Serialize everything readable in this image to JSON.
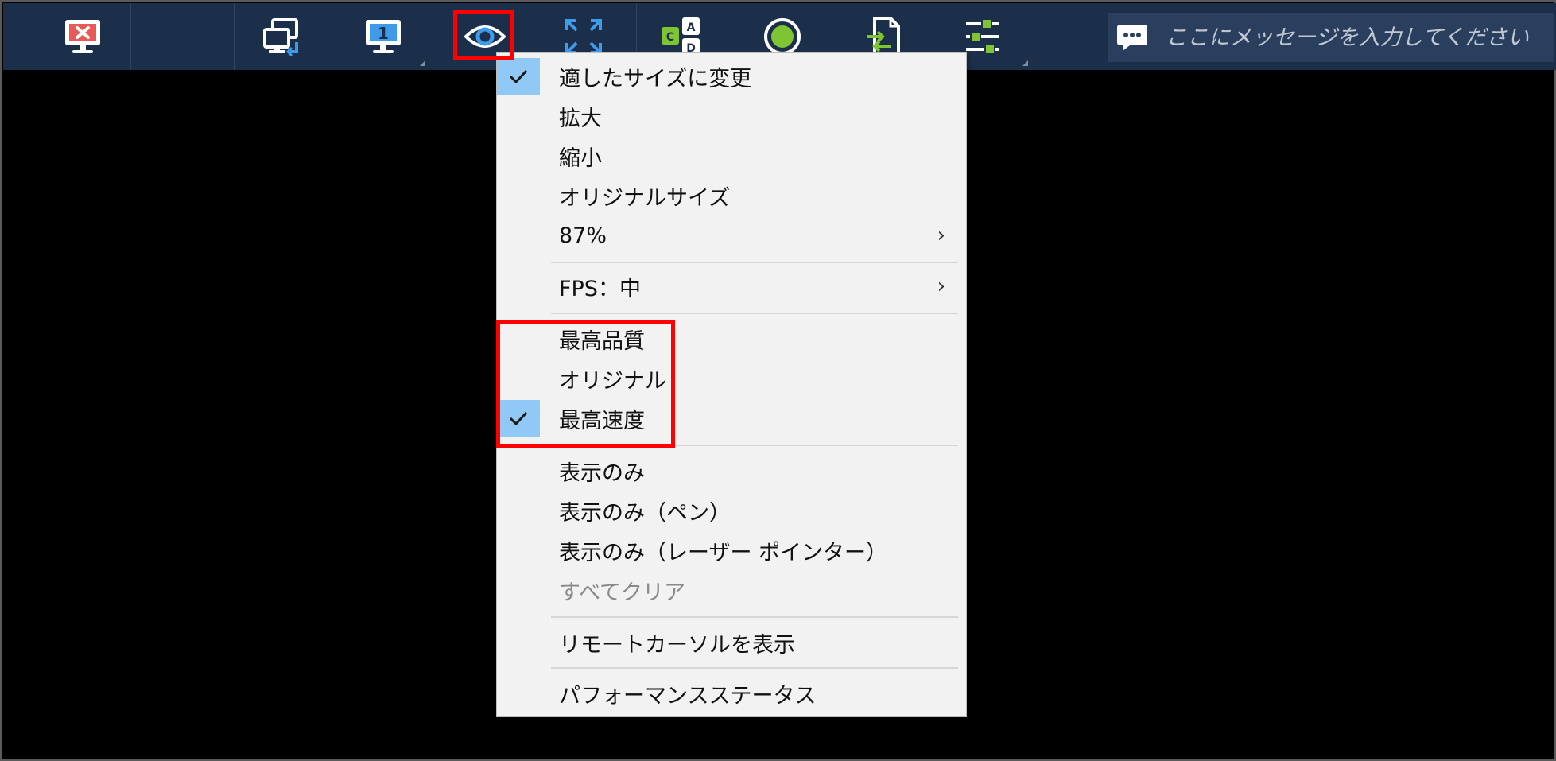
{
  "toolbar": {
    "buttons": [
      {
        "name": "disconnect"
      },
      {
        "name": "switch-remote-monitor"
      },
      {
        "name": "monitor-1"
      },
      {
        "name": "view-mode"
      },
      {
        "name": "fullscreen"
      },
      {
        "name": "clipboard-input"
      },
      {
        "name": "record"
      },
      {
        "name": "file-transfer"
      },
      {
        "name": "settings-options"
      }
    ],
    "monitor_number": "1",
    "message_placeholder": "ここにメッセージを入力してください",
    "colors": {
      "bar": "#1c2f4a",
      "accent_blue": "#3d9be9",
      "accent_green": "#7ec433",
      "highlight": "#ff0000"
    }
  },
  "menu": {
    "items": [
      {
        "label": "適したサイズに変更",
        "checked": true
      },
      {
        "label": "拡大"
      },
      {
        "label": "縮小"
      },
      {
        "label": "オリジナルサイズ"
      },
      {
        "label": "87%",
        "submenu": "›"
      },
      {
        "label": "FPS：中",
        "submenu": "›"
      },
      {
        "label": "最高品質"
      },
      {
        "label": "オリジナル"
      },
      {
        "label": "最高速度",
        "checked": true
      },
      {
        "label": "表示のみ"
      },
      {
        "label": "表示のみ（ペン）"
      },
      {
        "label": "表示のみ（レーザー ポインター）"
      },
      {
        "label": "すべてクリア",
        "disabled": true
      },
      {
        "label": "リモートカーソルを表示"
      },
      {
        "label": "パフォーマンスステータス"
      }
    ]
  }
}
